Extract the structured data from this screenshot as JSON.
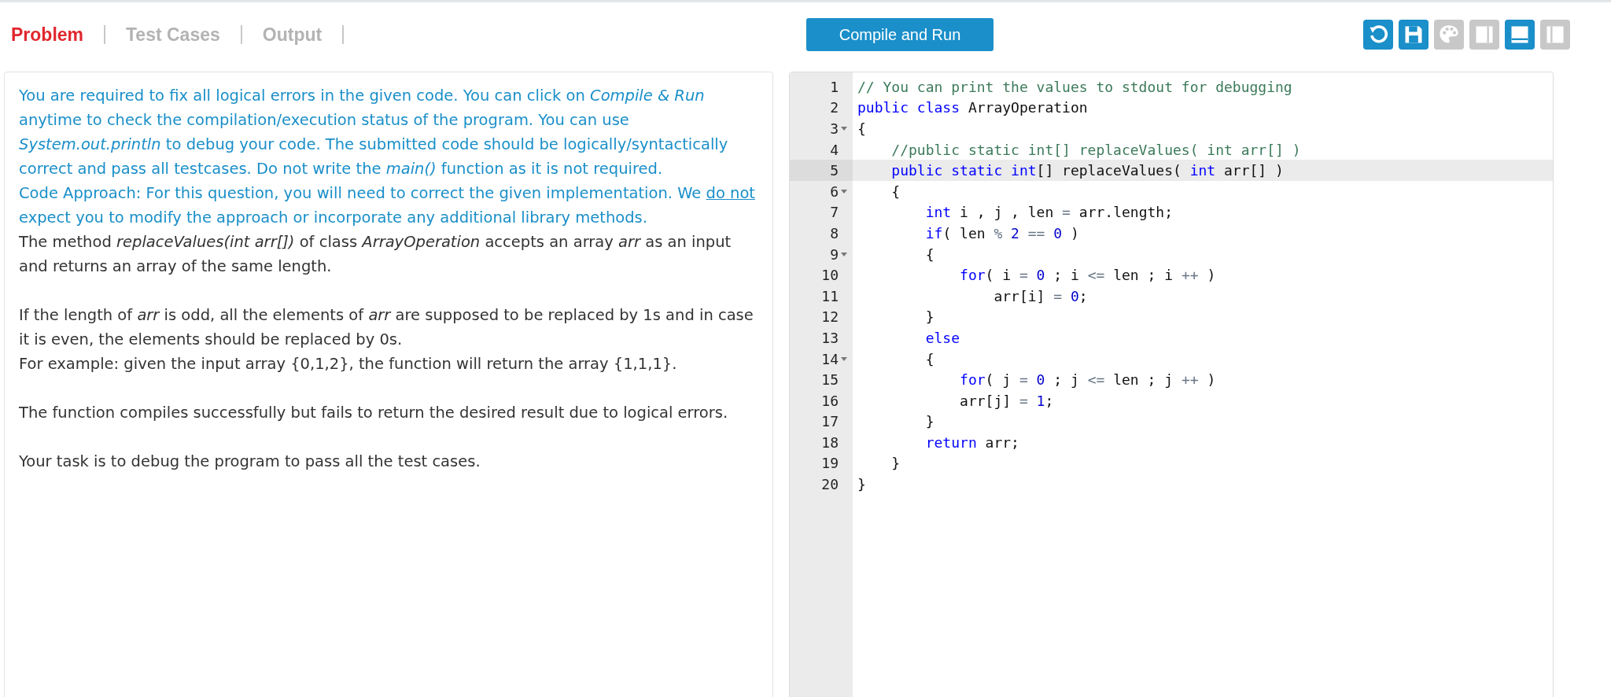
{
  "tabs": [
    {
      "label": "Problem",
      "selected": true
    },
    {
      "label": "Test Cases",
      "selected": false
    },
    {
      "label": "Output",
      "selected": false
    }
  ],
  "compile_button": "Compile and Run",
  "toolbar": [
    {
      "kind": "undo",
      "active": true
    },
    {
      "kind": "save",
      "active": true
    },
    {
      "kind": "palette",
      "active": false
    },
    {
      "kind": "split-right",
      "active": false
    },
    {
      "kind": "split-bottom",
      "active": true
    },
    {
      "kind": "split-left",
      "active": false
    }
  ],
  "problem": [
    {
      "kind": "note",
      "gap": false,
      "parts": [
        {
          "text": "You are required to fix all logical errors in the given code. You can click on *Compile & Run* anytime to check the compilation/execution status of the program. You can use *System.out.println* to debug your code. The submitted code should be logically/syntactically correct and pass all testcases. Do not write the *main()* function as it is not required.",
          "underline": false
        }
      ]
    },
    {
      "kind": "note",
      "gap": false,
      "parts": [
        {
          "text": "Code Approach: For this question, you will need to correct the given implementation. We ",
          "underline": false
        },
        {
          "text": "do not",
          "underline": true
        },
        {
          "text": " expect you to modify the approach or incorporate any additional library methods.",
          "underline": false
        }
      ]
    },
    {
      "kind": "body",
      "gap": false,
      "parts": [
        {
          "text": "The method *replaceValues(int arr[])* of class *ArrayOperation* accepts an array *arr* as an input and returns an array of the same length.",
          "underline": false
        }
      ]
    },
    {
      "kind": "body",
      "gap": true,
      "parts": [
        {
          "text": "If the length of *arr* is odd, all the elements of *arr* are supposed to be replaced by 1s and in case it is even, the elements should be replaced by 0s.",
          "underline": false
        }
      ]
    },
    {
      "kind": "body",
      "gap": false,
      "parts": [
        {
          "text": "For example: given the input array {0,1,2}, the function will return the array {1,1,1}.",
          "underline": false
        }
      ]
    },
    {
      "kind": "body",
      "gap": true,
      "parts": [
        {
          "text": "The function compiles successfully but fails to return the desired result due to logical errors.",
          "underline": false
        }
      ]
    },
    {
      "kind": "body",
      "gap": true,
      "parts": [
        {
          "text": "Your task is to debug the program to pass all the test cases.",
          "underline": false
        }
      ]
    }
  ],
  "editor": {
    "lines": [
      {
        "number": "1",
        "fold": false,
        "active": false,
        "tokens": [
          {
            "text": "// You can print the values to stdout for debugging",
            "kind": "comment"
          }
        ]
      },
      {
        "number": "2",
        "fold": false,
        "active": false,
        "tokens": [
          {
            "text": "public class",
            "kind": "keyword"
          },
          {
            "text": " ArrayOperation",
            "kind": "plain"
          }
        ]
      },
      {
        "number": "3",
        "fold": true,
        "active": false,
        "tokens": [
          {
            "text": "{",
            "kind": "plain"
          }
        ]
      },
      {
        "number": "4",
        "fold": false,
        "active": false,
        "tokens": [
          {
            "text": "    //public static int[] replaceValues( int arr[] )",
            "kind": "comment"
          }
        ]
      },
      {
        "number": "5",
        "fold": false,
        "active": true,
        "tokens": [
          {
            "text": "    public static int",
            "kind": "keyword"
          },
          {
            "text": "[] replaceValues( ",
            "kind": "plain"
          },
          {
            "text": "int",
            "kind": "keyword"
          },
          {
            "text": " arr[] )",
            "kind": "plain"
          }
        ]
      },
      {
        "number": "6",
        "fold": true,
        "active": false,
        "tokens": [
          {
            "text": "    {",
            "kind": "plain"
          }
        ]
      },
      {
        "number": "7",
        "fold": false,
        "active": false,
        "tokens": [
          {
            "text": "        int",
            "kind": "keyword"
          },
          {
            "text": " i , j , len ",
            "kind": "plain"
          },
          {
            "text": "= ",
            "kind": "operator"
          },
          {
            "text": "arr.length;",
            "kind": "plain"
          }
        ]
      },
      {
        "number": "8",
        "fold": false,
        "active": false,
        "tokens": [
          {
            "text": "        if",
            "kind": "keyword"
          },
          {
            "text": "( len ",
            "kind": "plain"
          },
          {
            "text": "% ",
            "kind": "operator"
          },
          {
            "text": "2 ",
            "kind": "number"
          },
          {
            "text": "== ",
            "kind": "operator"
          },
          {
            "text": "0",
            "kind": "number"
          },
          {
            "text": " )",
            "kind": "plain"
          }
        ]
      },
      {
        "number": "9",
        "fold": true,
        "active": false,
        "tokens": [
          {
            "text": "        {",
            "kind": "plain"
          }
        ]
      },
      {
        "number": "10",
        "fold": false,
        "active": false,
        "tokens": [
          {
            "text": "            for",
            "kind": "keyword"
          },
          {
            "text": "( i ",
            "kind": "plain"
          },
          {
            "text": "= ",
            "kind": "operator"
          },
          {
            "text": "0",
            "kind": "number"
          },
          {
            "text": " ; i ",
            "kind": "plain"
          },
          {
            "text": "<=",
            "kind": "operator"
          },
          {
            "text": " len ; i ",
            "kind": "plain"
          },
          {
            "text": "++",
            "kind": "operator"
          },
          {
            "text": " )",
            "kind": "plain"
          }
        ]
      },
      {
        "number": "11",
        "fold": false,
        "active": false,
        "tokens": [
          {
            "text": "                arr[i] ",
            "kind": "plain"
          },
          {
            "text": "= ",
            "kind": "operator"
          },
          {
            "text": "0",
            "kind": "number"
          },
          {
            "text": ";",
            "kind": "plain"
          }
        ]
      },
      {
        "number": "12",
        "fold": false,
        "active": false,
        "tokens": [
          {
            "text": "        }",
            "kind": "plain"
          }
        ]
      },
      {
        "number": "13",
        "fold": false,
        "active": false,
        "tokens": [
          {
            "text": "        else",
            "kind": "keyword"
          }
        ]
      },
      {
        "number": "14",
        "fold": true,
        "active": false,
        "tokens": [
          {
            "text": "        {",
            "kind": "plain"
          }
        ]
      },
      {
        "number": "15",
        "fold": false,
        "active": false,
        "tokens": [
          {
            "text": "            for",
            "kind": "keyword"
          },
          {
            "text": "( j ",
            "kind": "plain"
          },
          {
            "text": "= ",
            "kind": "operator"
          },
          {
            "text": "0",
            "kind": "number"
          },
          {
            "text": " ; j ",
            "kind": "plain"
          },
          {
            "text": "<=",
            "kind": "operator"
          },
          {
            "text": " len ; j ",
            "kind": "plain"
          },
          {
            "text": "++",
            "kind": "operator"
          },
          {
            "text": " )",
            "kind": "plain"
          }
        ]
      },
      {
        "number": "16",
        "fold": false,
        "active": false,
        "tokens": [
          {
            "text": "            arr[j] ",
            "kind": "plain"
          },
          {
            "text": "= ",
            "kind": "operator"
          },
          {
            "text": "1",
            "kind": "number"
          },
          {
            "text": ";",
            "kind": "plain"
          }
        ]
      },
      {
        "number": "17",
        "fold": false,
        "active": false,
        "tokens": [
          {
            "text": "        }",
            "kind": "plain"
          }
        ]
      },
      {
        "number": "18",
        "fold": false,
        "active": false,
        "tokens": [
          {
            "text": "        return",
            "kind": "keyword"
          },
          {
            "text": " arr;",
            "kind": "plain"
          }
        ]
      },
      {
        "number": "19",
        "fold": false,
        "active": false,
        "tokens": [
          {
            "text": "    }",
            "kind": "plain"
          }
        ]
      },
      {
        "number": "20",
        "fold": false,
        "active": false,
        "tokens": [
          {
            "text": "}",
            "kind": "plain"
          }
        ]
      }
    ]
  }
}
